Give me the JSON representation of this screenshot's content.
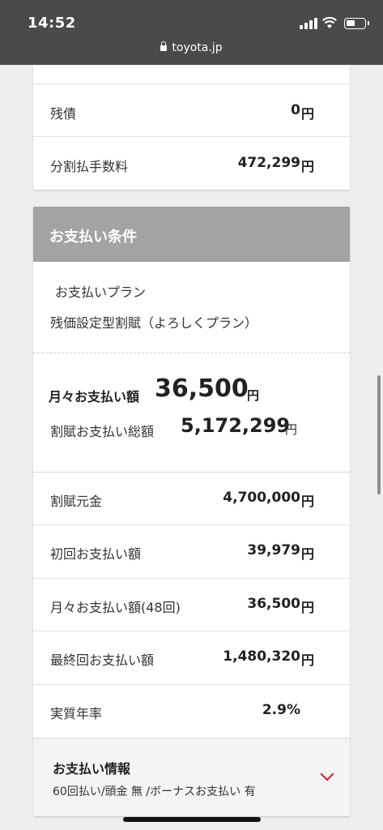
{
  "status_bar": {
    "time": "14:52",
    "url": "toyota.jp",
    "icons": [
      "signal-icon",
      "wifi-icon",
      "battery-icon",
      "lock-icon"
    ]
  },
  "top_section": {
    "rows": [
      {
        "label": "残債",
        "value": "0",
        "unit": "円"
      },
      {
        "label": "分割払手数料",
        "value": "472,299",
        "unit": "円"
      }
    ]
  },
  "payment_conditions": {
    "title": "お支払い条件",
    "plan_label": "お支払いプラン",
    "plan_value": "残価設定型割賦（よろしくプラン）",
    "monthly_label": "月々お支払い額",
    "monthly_value": "36,500",
    "monthly_unit": "円",
    "total_label": "割賦お支払い総額",
    "total_value": "5,172,299",
    "total_unit": "円",
    "rows": [
      {
        "label": "割賦元金",
        "value": "4,700,000",
        "unit": "円"
      },
      {
        "label": "初回お支払い額",
        "value": "39,979",
        "unit": "円"
      },
      {
        "label": "月々お支払い額(48回)",
        "value": "36,500",
        "unit": "円"
      },
      {
        "label": "最終回お支払い額",
        "value": "1,480,320",
        "unit": "円"
      },
      {
        "label": "実質年率",
        "value": "2.9%",
        "unit": ""
      }
    ]
  },
  "payment_info": {
    "title": "お支払い情報",
    "detail": "60回払い/頭金 無 /ボーナスお支払い 有"
  },
  "colors": {
    "status_bar": "#4a4a4a",
    "section_header": "#a3a3a3",
    "accent": "#cc1f2b"
  }
}
